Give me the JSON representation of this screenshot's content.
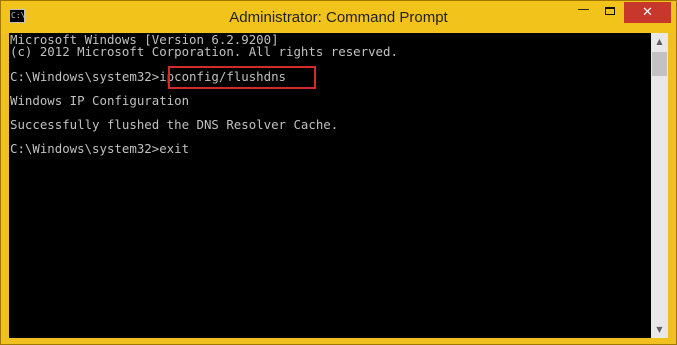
{
  "window": {
    "title": "Administrator: Command Prompt",
    "icon_glyph": "C:\\.",
    "minimize_glyph": "—",
    "close_glyph": "✕"
  },
  "console": {
    "lines": [
      "Microsoft Windows [Version 6.2.9200]",
      "(c) 2012 Microsoft Corporation. All rights reserved.",
      "C:\\Windows\\system32>ipconfig/flushdns",
      "Windows IP Configuration",
      "Successfully flushed the DNS Resolver Cache.",
      "C:\\Windows\\system32>exit"
    ],
    "highlighted_command": "ipconfig/flushdns"
  },
  "scrollbar": {
    "up_glyph": "▲",
    "down_glyph": "▼"
  },
  "colors": {
    "titlebar": "#f2c31a",
    "console_background": "#000000",
    "console_text": "#c0c0c0",
    "highlight_border": "#d42a2a",
    "close_button": "#c7372c"
  },
  "icons": [
    "command-prompt-icon",
    "minimize-icon",
    "maximize-icon",
    "close-icon",
    "scroll-up-icon",
    "scroll-down-icon"
  ]
}
